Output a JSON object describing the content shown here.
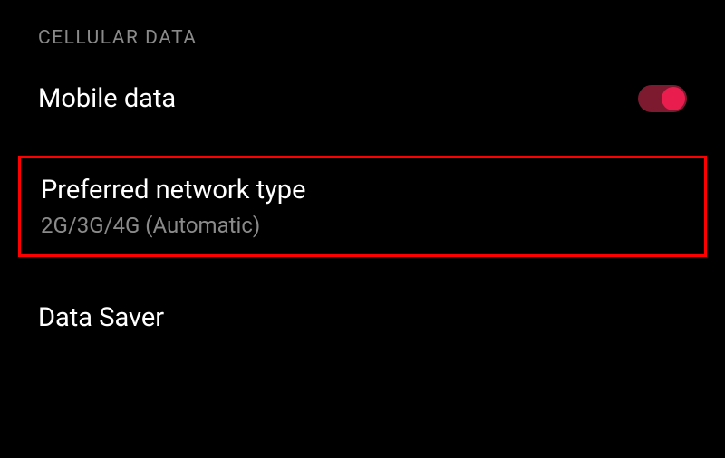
{
  "section": {
    "header": "CELLULAR DATA"
  },
  "settings": {
    "mobileData": {
      "title": "Mobile data",
      "enabled": true
    },
    "preferredNetwork": {
      "title": "Preferred network type",
      "subtitle": "2G/3G/4G (Automatic)"
    },
    "dataSaver": {
      "title": "Data Saver"
    }
  },
  "colors": {
    "accent": "#e91e4f",
    "highlight": "#ff0000"
  }
}
